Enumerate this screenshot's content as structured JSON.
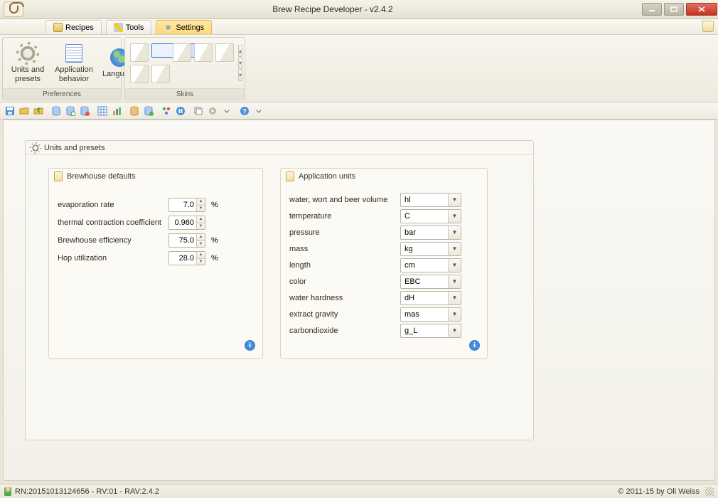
{
  "window": {
    "title": "Brew Recipe Developer - v2.4.2"
  },
  "tabs": {
    "recipes": "Recipes",
    "tools": "Tools",
    "settings": "Settings",
    "active": "settings"
  },
  "ribbon": {
    "groups": {
      "preferences": "Preferences",
      "skins": "Skins"
    },
    "buttons": {
      "units_presets": "Units and presets",
      "app_behavior": "Application behavior",
      "language": "Language"
    }
  },
  "panel": {
    "title": "Units and presets",
    "brewhouse": {
      "title": "Brewhouse defaults",
      "rows": {
        "evaporation": {
          "label": "evaporation rate",
          "value": "7.0",
          "unit": "%"
        },
        "contraction": {
          "label": "thermal contraction coefficient",
          "value": "0.960",
          "unit": ""
        },
        "efficiency": {
          "label": "Brewhouse efficiency",
          "value": "75.0",
          "unit": "%"
        },
        "hop": {
          "label": "Hop utilization",
          "value": "28.0",
          "unit": "%"
        }
      }
    },
    "appunits": {
      "title": "Application units",
      "rows": {
        "volume": {
          "label": "water, wort and beer volume",
          "value": "hl"
        },
        "temperature": {
          "label": "temperature",
          "value": "C"
        },
        "pressure": {
          "label": "pressure",
          "value": "bar"
        },
        "mass": {
          "label": "mass",
          "value": "kg"
        },
        "length": {
          "label": "length",
          "value": "cm"
        },
        "color": {
          "label": "color",
          "value": "EBC"
        },
        "hardness": {
          "label": "water hardness",
          "value": "dH"
        },
        "gravity": {
          "label": "extract gravity",
          "value": "mas"
        },
        "co2": {
          "label": "carbondioxide",
          "value": "g_L"
        }
      }
    }
  },
  "status": {
    "text": "RN:20151013124656 - RV:01 - RAV:2.4.2",
    "copyright": "© 2011-15 by Oli Weiss"
  }
}
